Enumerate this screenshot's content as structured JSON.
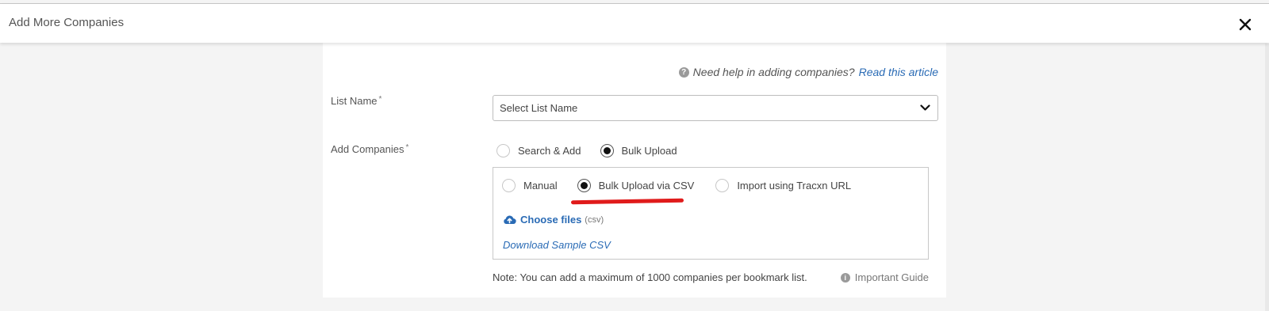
{
  "header": {
    "title": "Add More Companies",
    "close_icon": "close-icon"
  },
  "help": {
    "icon": "question-circle-icon",
    "text": "Need help in adding companies?",
    "link": "Read this article"
  },
  "list_name": {
    "label": "List Name",
    "required_mark": "*",
    "select_value": "Select List Name",
    "chevron_icon": "chevron-down-icon"
  },
  "add_companies": {
    "label": "Add Companies",
    "required_mark": "*",
    "options": [
      {
        "label": "Search & Add",
        "selected": false
      },
      {
        "label": "Bulk Upload",
        "selected": true
      }
    ],
    "methods": [
      {
        "label": "Manual",
        "selected": false
      },
      {
        "label": "Bulk Upload via CSV",
        "selected": true
      },
      {
        "label": "Import using Tracxn URL",
        "selected": false
      }
    ],
    "choose_files": {
      "label": "Choose files",
      "hint": "(csv)",
      "icon": "cloud-upload-icon"
    },
    "download_sample": "Download Sample CSV"
  },
  "footer": {
    "note": "Note: You can add a maximum of 1000 companies per bookmark list.",
    "guide_icon": "info-circle-icon",
    "guide_label": "Important Guide"
  },
  "colors": {
    "link": "#2a6bb5",
    "highlight_underline": "#e01b1b",
    "page_bg": "#f4f4f4"
  }
}
